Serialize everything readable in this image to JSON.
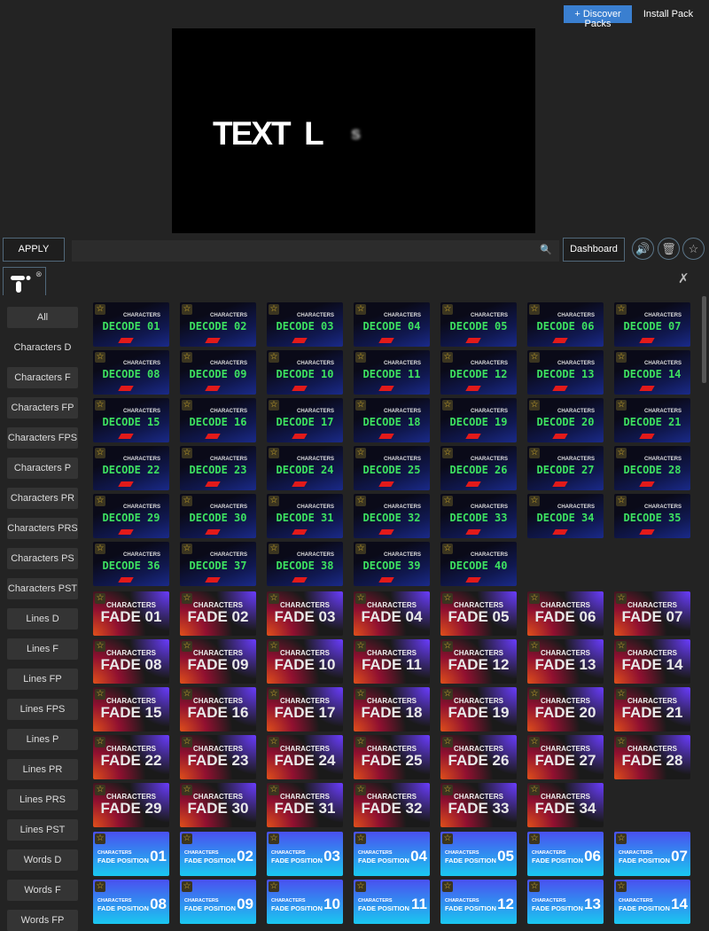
{
  "header": {
    "discover_line1": "+ Discover",
    "discover_line2": "Packs",
    "install_pack": "Install Pack"
  },
  "preview": {
    "text": "TEXT  L",
    "blur_char": "s"
  },
  "toolbar": {
    "apply": "APPLY",
    "search_placeholder": "",
    "dashboard": "Dashboard",
    "icons": [
      "speaker-icon",
      "trash-icon",
      "star-icon"
    ]
  },
  "tab": {
    "close": "⊗"
  },
  "sidebar": {
    "items": [
      "All",
      "Characters D",
      "Characters F",
      "Characters FP",
      "Characters FPS",
      "Characters P",
      "Characters PR",
      "Characters PRS",
      "Characters PS",
      "Characters PST",
      "Lines D",
      "Lines F",
      "Lines FP",
      "Lines FPS",
      "Lines P",
      "Lines PR",
      "Lines PRS",
      "Lines PST",
      "Words D",
      "Words F",
      "Words FP"
    ],
    "selected": "All"
  },
  "presets": {
    "decode": {
      "label": "CHARACTERS",
      "prefix": "DECODE",
      "count": 40,
      "accent": "#3de060"
    },
    "fade": {
      "label": "CHARACTERS",
      "prefix": "FADE",
      "count": 34
    },
    "fade_position": {
      "label": "CHARACTERS",
      "prefix": "FADE POSITION",
      "count": 14
    }
  }
}
